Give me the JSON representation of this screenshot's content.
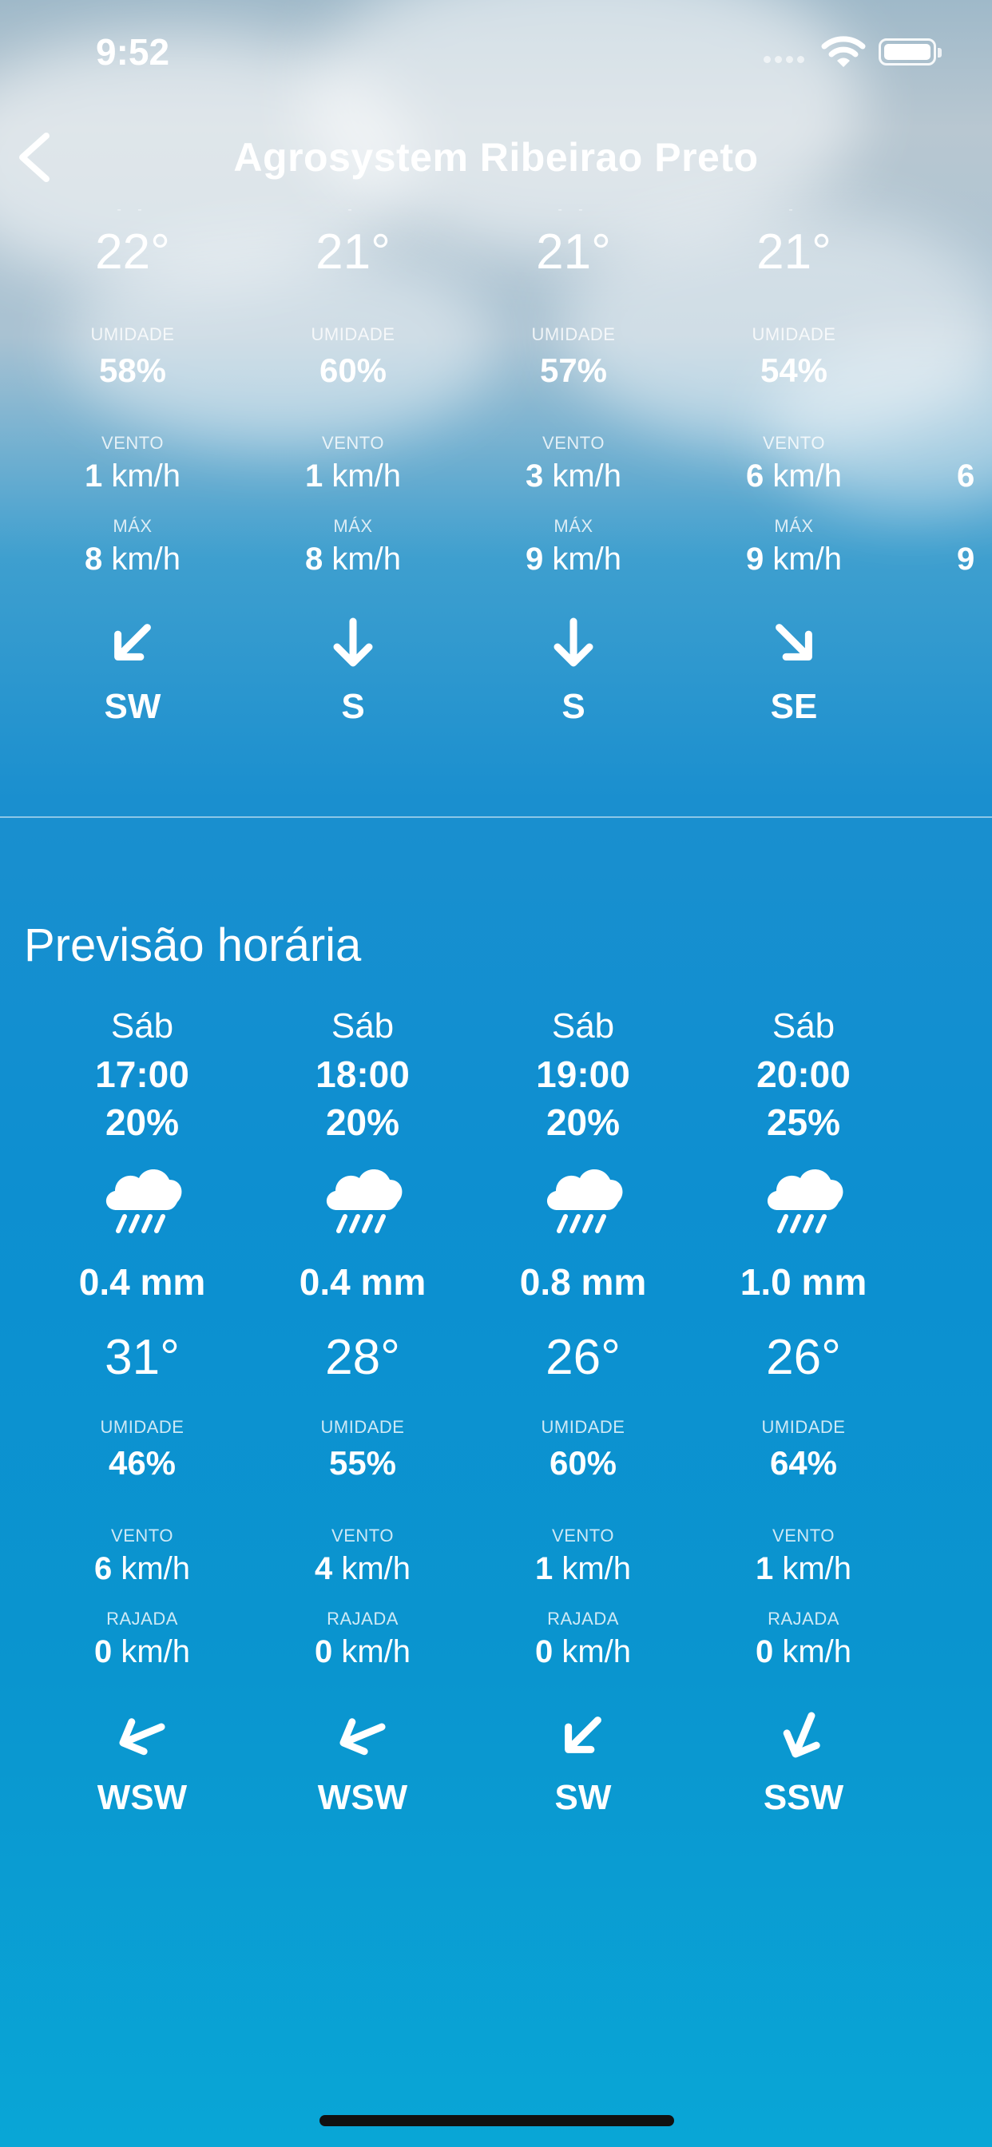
{
  "status_bar": {
    "time": "9:52"
  },
  "nav": {
    "title": "Agrosystem Ribeirao Preto"
  },
  "daily": [
    {
      "temp": "22°",
      "humidity_label": "UMIDADE",
      "humidity": "58%",
      "wind_label": "VENTO",
      "wind_value": "1",
      "wind_unit": "km/h",
      "max_label": "MÁX",
      "max_value": "8",
      "max_unit": "km/h",
      "direction": "SW",
      "arrow_icon": "arrow-sw-icon"
    },
    {
      "temp": "21°",
      "humidity_label": "UMIDADE",
      "humidity": "60%",
      "wind_label": "VENTO",
      "wind_value": "1",
      "wind_unit": "km/h",
      "max_label": "MÁX",
      "max_value": "8",
      "max_unit": "km/h",
      "direction": "S",
      "arrow_icon": "arrow-s-icon"
    },
    {
      "temp": "21°",
      "humidity_label": "UMIDADE",
      "humidity": "57%",
      "wind_label": "VENTO",
      "wind_value": "3",
      "wind_unit": "km/h",
      "max_label": "MÁX",
      "max_value": "9",
      "max_unit": "km/h",
      "direction": "S",
      "arrow_icon": "arrow-s-icon"
    },
    {
      "temp": "21°",
      "humidity_label": "UMIDADE",
      "humidity": "54%",
      "wind_label": "VENTO",
      "wind_value": "6",
      "wind_unit": "km/h",
      "max_label": "MÁX",
      "max_value": "9",
      "max_unit": "km/h",
      "direction": "SE",
      "arrow_icon": "arrow-se-icon"
    },
    {
      "wind_value": "6",
      "max_value": "9"
    }
  ],
  "hourly": {
    "title": "Previsão horária",
    "items": [
      {
        "day": "Sáb",
        "hour": "17:00",
        "prob": "20%",
        "icon": "rain-cloud-icon",
        "mm": "0.4 mm",
        "temp": "31°",
        "humidity_label": "UMIDADE",
        "humidity": "46%",
        "wind_label": "VENTO",
        "wind_value": "6",
        "wind_unit": "km/h",
        "gust_label": "RAJADA",
        "gust_value": "0",
        "gust_unit": "km/h",
        "direction": "WSW",
        "arrow_icon": "arrow-wsw-icon"
      },
      {
        "day": "Sáb",
        "hour": "18:00",
        "prob": "20%",
        "icon": "rain-cloud-icon",
        "mm": "0.4 mm",
        "temp": "28°",
        "humidity_label": "UMIDADE",
        "humidity": "55%",
        "wind_label": "VENTO",
        "wind_value": "4",
        "wind_unit": "km/h",
        "gust_label": "RAJADA",
        "gust_value": "0",
        "gust_unit": "km/h",
        "direction": "WSW",
        "arrow_icon": "arrow-wsw-icon"
      },
      {
        "day": "Sáb",
        "hour": "19:00",
        "prob": "20%",
        "icon": "rain-cloud-icon",
        "mm": "0.8 mm",
        "temp": "26°",
        "humidity_label": "UMIDADE",
        "humidity": "60%",
        "wind_label": "VENTO",
        "wind_value": "1",
        "wind_unit": "km/h",
        "gust_label": "RAJADA",
        "gust_value": "0",
        "gust_unit": "km/h",
        "direction": "SW",
        "arrow_icon": "arrow-sw-icon"
      },
      {
        "day": "Sáb",
        "hour": "20:00",
        "prob": "25%",
        "icon": "rain-cloud-icon",
        "mm": "1.0 mm",
        "temp": "26°",
        "humidity_label": "UMIDADE",
        "humidity": "64%",
        "wind_label": "VENTO",
        "wind_value": "1",
        "wind_unit": "km/h",
        "gust_label": "RAJADA",
        "gust_value": "0",
        "gust_unit": "km/h",
        "direction": "SSW",
        "arrow_icon": "arrow-ssw-icon"
      }
    ]
  }
}
